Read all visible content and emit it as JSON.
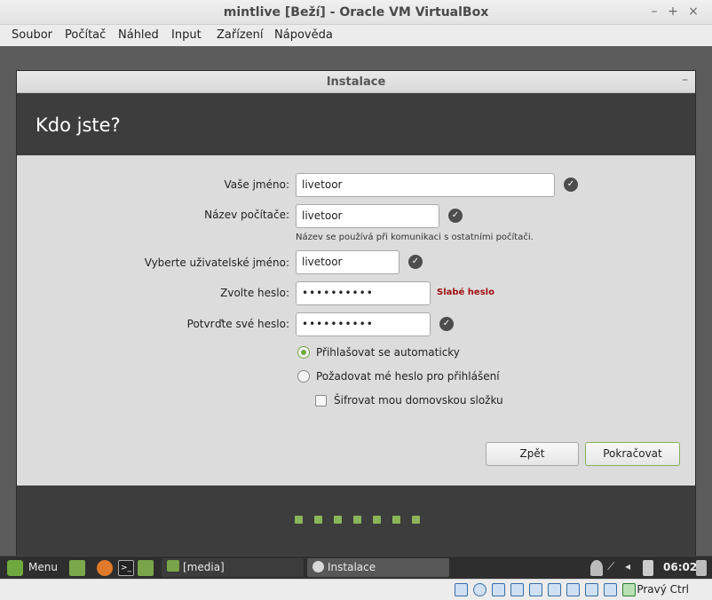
{
  "host": {
    "title": "mintlive [Beží] - Oracle VM VirtualBox",
    "window_controls": [
      "–",
      "+",
      "×"
    ],
    "menu": [
      "Soubor",
      "Počítač",
      "Náhled",
      "Input",
      "Zařízení",
      "Nápověda"
    ],
    "status_host_key": "Pravý Ctrl"
  },
  "installer": {
    "window_title": "Instalace",
    "minimize_glyph": "–",
    "heading": "Kdo jste?",
    "fields": {
      "your_name_label": "Vaše jméno:",
      "your_name_value": "livetoor",
      "computer_name_label": "Název počítače:",
      "computer_name_value": "livetoor",
      "computer_name_hint": "Název se používá při komunikaci s ostatními počítači.",
      "username_label": "Vyberte uživatelské jméno:",
      "username_value": "livetoor",
      "password_label": "Zvolte heslo:",
      "password_value": "••••••••••",
      "password_strength": "Slabé heslo",
      "confirm_label": "Potvrďte své heslo:",
      "confirm_value": "••••••••••"
    },
    "options": {
      "autologin": "Přihlašovat se automaticky",
      "require_password": "Požadovat mé heslo pro přihlášení",
      "encrypt_home": "Šifrovat mou domovskou složku"
    },
    "buttons": {
      "back": "Zpět",
      "continue": "Pokračovat"
    },
    "progress": {
      "steps": 7
    }
  },
  "panel": {
    "menu_label": "Menu",
    "tasks": [
      "[media]",
      "Instalace"
    ],
    "clock": "06:02"
  },
  "colors": {
    "accent": "#8ab55a",
    "weak": "#a01010",
    "dark": "#3d3d3d"
  }
}
